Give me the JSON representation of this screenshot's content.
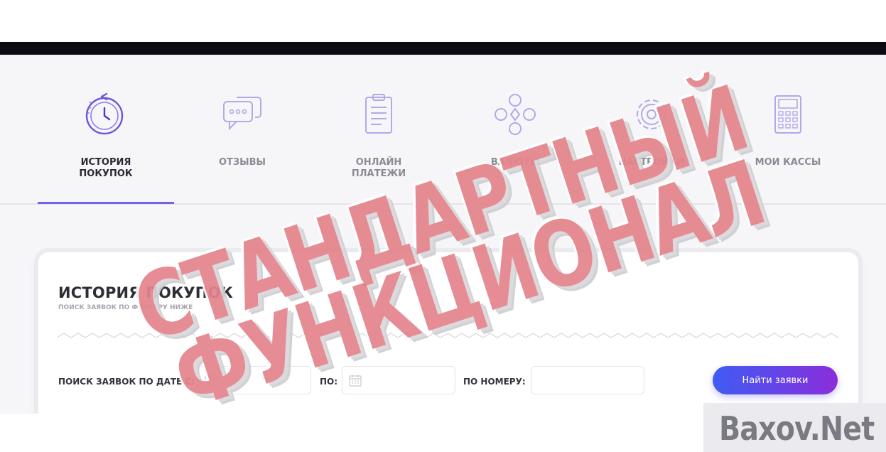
{
  "nav": {
    "items": [
      {
        "label": "ИСТОРИЯ\nПОКУПОК",
        "icon": "clock-history-icon",
        "active": true
      },
      {
        "label": "ОТЗЫВЫ",
        "icon": "chat-bubbles-icon",
        "active": false
      },
      {
        "label": "ОНЛАЙН\nПЛАТЕЖИ",
        "icon": "clipboard-icon",
        "active": false
      },
      {
        "label": "ВАЛЮТЫ",
        "icon": "currencies-icon",
        "active": false
      },
      {
        "label": "НАСТРОЙКИ",
        "icon": "gear-icon",
        "active": false
      },
      {
        "label": "МОИ КАССЫ",
        "icon": "calculator-icon",
        "active": false
      }
    ],
    "accent_color": "#6f63e6"
  },
  "card": {
    "title": "ИСТОРИЯ ПОКУПОК",
    "subtitle": "ПОИСК ЗАЯВОК ПО ФИЛЬТРУ НИЖЕ"
  },
  "filter": {
    "date_from_label": "ПОИСК ЗАЯВОК ПО ДАТЕ С:",
    "date_from_value": "",
    "date_to_label": "ПО:",
    "date_to_value": "",
    "number_label": "ПО НОМЕРУ:",
    "number_value": "",
    "submit_label": "Найти заявки",
    "button_gradient": [
      "#3f5cf4",
      "#8a2ddb"
    ]
  },
  "overlay": {
    "stamp_line1": "СТАНДАРТНЫЙ",
    "stamp_line2": "ФУНКЦИОНАЛ",
    "stamp_color": "#e4848c",
    "watermark": "Baxov.Net"
  }
}
